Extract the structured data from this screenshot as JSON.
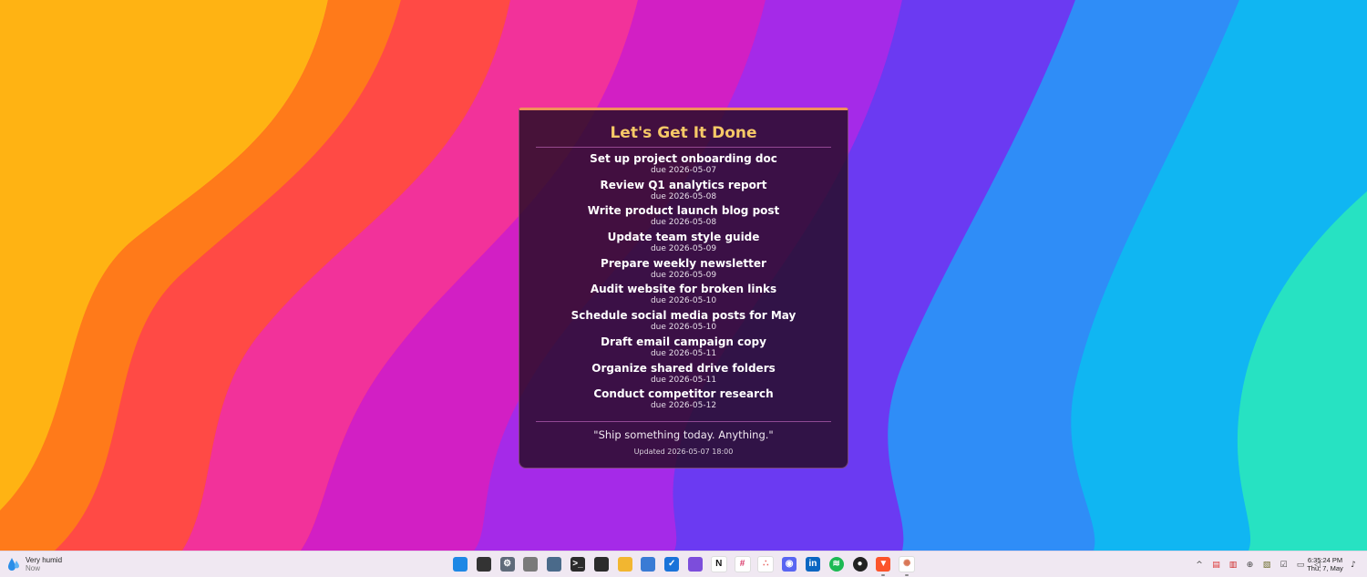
{
  "widget": {
    "title": "Let's Get It Done",
    "tasks": [
      {
        "name": "Set up project onboarding doc",
        "due": "due 2026-05-07"
      },
      {
        "name": "Review Q1 analytics report",
        "due": "due 2026-05-08"
      },
      {
        "name": "Write product launch blog post",
        "due": "due 2026-05-08"
      },
      {
        "name": "Update team style guide",
        "due": "due 2026-05-09"
      },
      {
        "name": "Prepare weekly newsletter",
        "due": "due 2026-05-09"
      },
      {
        "name": "Audit website for broken links",
        "due": "due 2026-05-10"
      },
      {
        "name": "Schedule social media posts for May",
        "due": "due 2026-05-10"
      },
      {
        "name": "Draft email campaign copy",
        "due": "due 2026-05-11"
      },
      {
        "name": "Organize shared drive folders",
        "due": "due 2026-05-11"
      },
      {
        "name": "Conduct competitor research",
        "due": "due 2026-05-12"
      }
    ],
    "quote": "\"Ship something today. Anything.\"",
    "updated": "Updated 2026-05-07 18:00",
    "accent_color": "#f0915a",
    "title_color": "#f6c867"
  },
  "taskbar": {
    "weather": {
      "line1": "Very humid",
      "line2": "Now",
      "icon": "water-drop-icon"
    },
    "apps": [
      {
        "name": "start-icon",
        "color": "#1e88e5",
        "glyph": ""
      },
      {
        "name": "task-view-icon",
        "color": "#333333",
        "glyph": ""
      },
      {
        "name": "settings-icon",
        "color": "#5f6b7a",
        "glyph": "⚙"
      },
      {
        "name": "usb-drive-icon",
        "color": "#7a7a7a",
        "glyph": ""
      },
      {
        "name": "calculator-icon",
        "color": "#4a6a8a",
        "glyph": ""
      },
      {
        "name": "terminal-icon",
        "color": "#2b2b2b",
        "glyph": ">_"
      },
      {
        "name": "sticky-notes-icon",
        "color": "#2b2b2b",
        "glyph": ""
      },
      {
        "name": "file-explorer-icon",
        "color": "#f2b630",
        "glyph": ""
      },
      {
        "name": "notepad-icon",
        "color": "#3a7bd5",
        "glyph": ""
      },
      {
        "name": "todo-icon",
        "color": "#1a73d9",
        "glyph": "✓"
      },
      {
        "name": "obsidian-icon",
        "color": "#7c4ddb",
        "glyph": ""
      },
      {
        "name": "notion-icon",
        "color": "#ffffff",
        "glyph": "N",
        "fg": "#111111"
      },
      {
        "name": "slack-icon",
        "color": "#ffffff",
        "glyph": "#",
        "fg": "#d93a6a"
      },
      {
        "name": "asana-icon",
        "color": "#ffffff",
        "glyph": "∴",
        "fg": "#e8625f"
      },
      {
        "name": "discord-icon",
        "color": "#5865f2",
        "glyph": "◉"
      },
      {
        "name": "linkedin-icon",
        "color": "#0a66c2",
        "glyph": "in"
      },
      {
        "name": "spotify-icon",
        "color": "#1db954",
        "glyph": "≋",
        "round": true
      },
      {
        "name": "github-icon",
        "color": "#222222",
        "glyph": "●",
        "round": true
      },
      {
        "name": "brave-icon",
        "color": "#fb542b",
        "glyph": "▼",
        "running": true
      },
      {
        "name": "claude-icon",
        "color": "#ffffff",
        "glyph": "✺",
        "fg": "#d97757",
        "running": true
      }
    ],
    "tray": [
      {
        "name": "chevron-up-icon",
        "glyph": "^"
      },
      {
        "name": "pdf-app-icon",
        "glyph": "▤",
        "fg": "#d33"
      },
      {
        "name": "calendar-app-icon",
        "glyph": "▥",
        "fg": "#c22"
      },
      {
        "name": "network-globe-icon",
        "glyph": "⊕"
      },
      {
        "name": "app-tray-icon",
        "glyph": "▧",
        "fg": "#6b6b2a"
      },
      {
        "name": "security-icon",
        "glyph": "☑"
      },
      {
        "name": "display-icon",
        "glyph": "▭"
      },
      {
        "name": "volume-icon",
        "glyph": "◁"
      }
    ],
    "clock": {
      "time": "6:35:24 PM",
      "date": "Thu, 7, May"
    }
  }
}
